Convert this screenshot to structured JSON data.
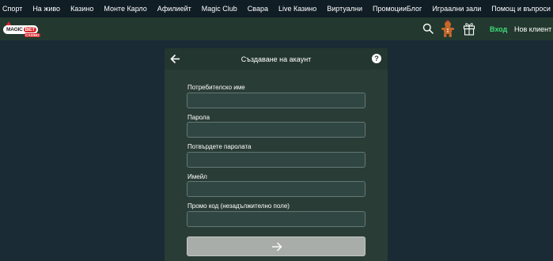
{
  "topnav": {
    "left_items": [
      "Спорт",
      "На живо",
      "Казино",
      "Монте Карло",
      "Афилиейт",
      "Magic Club",
      "Свара",
      "Live Казино",
      "Виртуални",
      "Промоции"
    ],
    "right_items": [
      "Блог",
      "Играални зали",
      "Помощ и въпроси"
    ]
  },
  "brand": {
    "logo_magic": "MAGIC",
    "logo_bet": "BET",
    "logo_casino": "CASINO"
  },
  "header_actions": {
    "login_label": "Вход",
    "register_label": "Нов клиент"
  },
  "modal": {
    "title": "Създаване на акаунт",
    "fields": [
      {
        "label": "Потребителско име",
        "value": ""
      },
      {
        "label": "Парола",
        "value": ""
      },
      {
        "label": "Потвърдете паролата",
        "value": ""
      },
      {
        "label": "Имейл",
        "value": ""
      },
      {
        "label": "Промо код (незадължително поле)",
        "value": ""
      }
    ]
  },
  "colors": {
    "background": "#1a2b36",
    "topnav": "#101d25",
    "brandbar": "#23392f",
    "modal": "#2a3c36",
    "login_accent": "#3ddc7a",
    "submit_disabled": "#a8adaa"
  },
  "icons": {
    "back": "arrow-left-icon",
    "help": "question-circle-icon",
    "search": "search-icon",
    "mascot": "gingerbread-icon",
    "gift": "gift-icon",
    "submit": "arrow-right-icon"
  }
}
